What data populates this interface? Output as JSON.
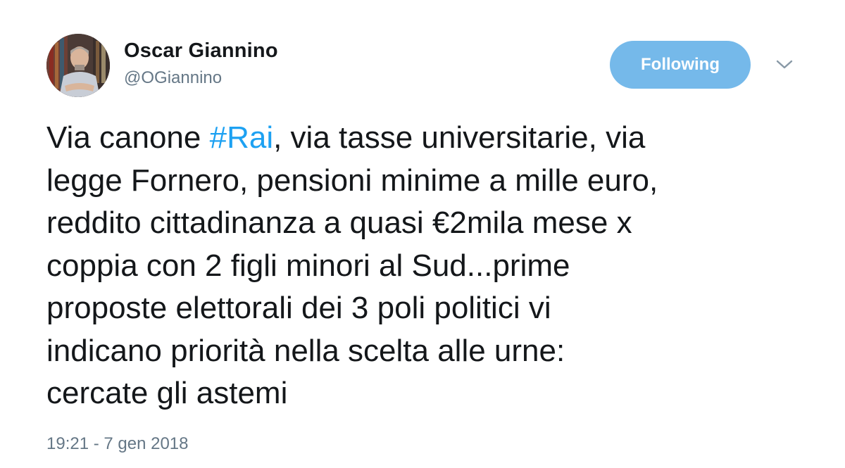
{
  "author": {
    "name": "Oscar Giannino",
    "handle": "@OGiannino"
  },
  "follow_button": {
    "label": "Following",
    "color": "#75b9ea"
  },
  "menu": {
    "icon": "chevron-down-icon"
  },
  "tweet": {
    "line1_before": "Via canone ",
    "hashtag": "#Rai",
    "line1_after": ", via tasse universitarie, via",
    "line2": "legge Fornero, pensioni minime a mille euro,",
    "line3": "reddito cittadinanza a quasi €2mila mese x",
    "line4": "coppia con 2 figli minori al Sud...prime",
    "line5": "proposte elettorali dei 3 poli politici vi",
    "line6": "indicano priorità nella scelta alle urne:",
    "line7": "cercate gli astemi"
  },
  "timestamp": "19:21 - 7 gen 2018",
  "colors": {
    "text": "#14171a",
    "secondary": "#657786",
    "link": "#1da1f2"
  }
}
